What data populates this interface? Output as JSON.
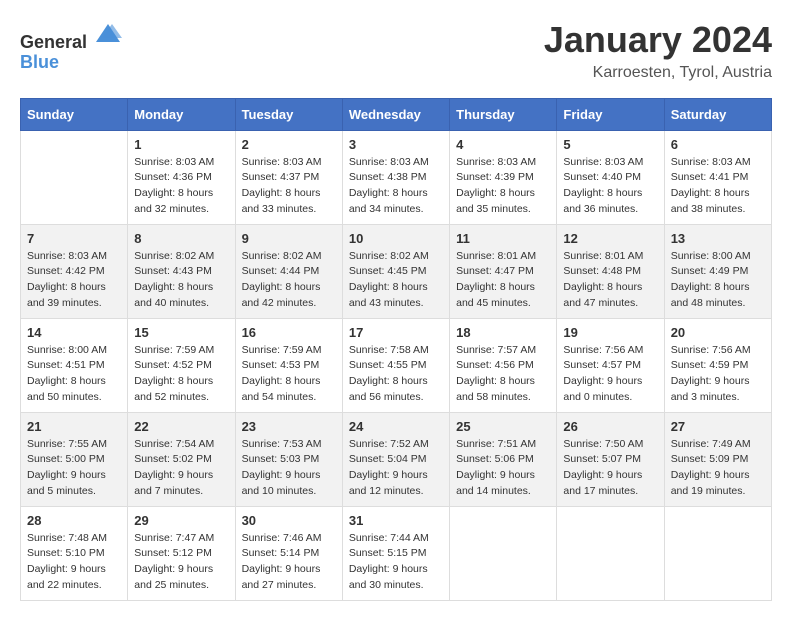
{
  "logo": {
    "general": "General",
    "blue": "Blue"
  },
  "title": "January 2024",
  "subtitle": "Karroesten, Tyrol, Austria",
  "headers": [
    "Sunday",
    "Monday",
    "Tuesday",
    "Wednesday",
    "Thursday",
    "Friday",
    "Saturday"
  ],
  "weeks": [
    {
      "days": [
        {
          "number": "",
          "sunrise": "",
          "sunset": "",
          "daylight": ""
        },
        {
          "number": "1",
          "sunrise": "Sunrise: 8:03 AM",
          "sunset": "Sunset: 4:36 PM",
          "daylight": "Daylight: 8 hours and 32 minutes."
        },
        {
          "number": "2",
          "sunrise": "Sunrise: 8:03 AM",
          "sunset": "Sunset: 4:37 PM",
          "daylight": "Daylight: 8 hours and 33 minutes."
        },
        {
          "number": "3",
          "sunrise": "Sunrise: 8:03 AM",
          "sunset": "Sunset: 4:38 PM",
          "daylight": "Daylight: 8 hours and 34 minutes."
        },
        {
          "number": "4",
          "sunrise": "Sunrise: 8:03 AM",
          "sunset": "Sunset: 4:39 PM",
          "daylight": "Daylight: 8 hours and 35 minutes."
        },
        {
          "number": "5",
          "sunrise": "Sunrise: 8:03 AM",
          "sunset": "Sunset: 4:40 PM",
          "daylight": "Daylight: 8 hours and 36 minutes."
        },
        {
          "number": "6",
          "sunrise": "Sunrise: 8:03 AM",
          "sunset": "Sunset: 4:41 PM",
          "daylight": "Daylight: 8 hours and 38 minutes."
        }
      ]
    },
    {
      "days": [
        {
          "number": "7",
          "sunrise": "Sunrise: 8:03 AM",
          "sunset": "Sunset: 4:42 PM",
          "daylight": "Daylight: 8 hours and 39 minutes."
        },
        {
          "number": "8",
          "sunrise": "Sunrise: 8:02 AM",
          "sunset": "Sunset: 4:43 PM",
          "daylight": "Daylight: 8 hours and 40 minutes."
        },
        {
          "number": "9",
          "sunrise": "Sunrise: 8:02 AM",
          "sunset": "Sunset: 4:44 PM",
          "daylight": "Daylight: 8 hours and 42 minutes."
        },
        {
          "number": "10",
          "sunrise": "Sunrise: 8:02 AM",
          "sunset": "Sunset: 4:45 PM",
          "daylight": "Daylight: 8 hours and 43 minutes."
        },
        {
          "number": "11",
          "sunrise": "Sunrise: 8:01 AM",
          "sunset": "Sunset: 4:47 PM",
          "daylight": "Daylight: 8 hours and 45 minutes."
        },
        {
          "number": "12",
          "sunrise": "Sunrise: 8:01 AM",
          "sunset": "Sunset: 4:48 PM",
          "daylight": "Daylight: 8 hours and 47 minutes."
        },
        {
          "number": "13",
          "sunrise": "Sunrise: 8:00 AM",
          "sunset": "Sunset: 4:49 PM",
          "daylight": "Daylight: 8 hours and 48 minutes."
        }
      ]
    },
    {
      "days": [
        {
          "number": "14",
          "sunrise": "Sunrise: 8:00 AM",
          "sunset": "Sunset: 4:51 PM",
          "daylight": "Daylight: 8 hours and 50 minutes."
        },
        {
          "number": "15",
          "sunrise": "Sunrise: 7:59 AM",
          "sunset": "Sunset: 4:52 PM",
          "daylight": "Daylight: 8 hours and 52 minutes."
        },
        {
          "number": "16",
          "sunrise": "Sunrise: 7:59 AM",
          "sunset": "Sunset: 4:53 PM",
          "daylight": "Daylight: 8 hours and 54 minutes."
        },
        {
          "number": "17",
          "sunrise": "Sunrise: 7:58 AM",
          "sunset": "Sunset: 4:55 PM",
          "daylight": "Daylight: 8 hours and 56 minutes."
        },
        {
          "number": "18",
          "sunrise": "Sunrise: 7:57 AM",
          "sunset": "Sunset: 4:56 PM",
          "daylight": "Daylight: 8 hours and 58 minutes."
        },
        {
          "number": "19",
          "sunrise": "Sunrise: 7:56 AM",
          "sunset": "Sunset: 4:57 PM",
          "daylight": "Daylight: 9 hours and 0 minutes."
        },
        {
          "number": "20",
          "sunrise": "Sunrise: 7:56 AM",
          "sunset": "Sunset: 4:59 PM",
          "daylight": "Daylight: 9 hours and 3 minutes."
        }
      ]
    },
    {
      "days": [
        {
          "number": "21",
          "sunrise": "Sunrise: 7:55 AM",
          "sunset": "Sunset: 5:00 PM",
          "daylight": "Daylight: 9 hours and 5 minutes."
        },
        {
          "number": "22",
          "sunrise": "Sunrise: 7:54 AM",
          "sunset": "Sunset: 5:02 PM",
          "daylight": "Daylight: 9 hours and 7 minutes."
        },
        {
          "number": "23",
          "sunrise": "Sunrise: 7:53 AM",
          "sunset": "Sunset: 5:03 PM",
          "daylight": "Daylight: 9 hours and 10 minutes."
        },
        {
          "number": "24",
          "sunrise": "Sunrise: 7:52 AM",
          "sunset": "Sunset: 5:04 PM",
          "daylight": "Daylight: 9 hours and 12 minutes."
        },
        {
          "number": "25",
          "sunrise": "Sunrise: 7:51 AM",
          "sunset": "Sunset: 5:06 PM",
          "daylight": "Daylight: 9 hours and 14 minutes."
        },
        {
          "number": "26",
          "sunrise": "Sunrise: 7:50 AM",
          "sunset": "Sunset: 5:07 PM",
          "daylight": "Daylight: 9 hours and 17 minutes."
        },
        {
          "number": "27",
          "sunrise": "Sunrise: 7:49 AM",
          "sunset": "Sunset: 5:09 PM",
          "daylight": "Daylight: 9 hours and 19 minutes."
        }
      ]
    },
    {
      "days": [
        {
          "number": "28",
          "sunrise": "Sunrise: 7:48 AM",
          "sunset": "Sunset: 5:10 PM",
          "daylight": "Daylight: 9 hours and 22 minutes."
        },
        {
          "number": "29",
          "sunrise": "Sunrise: 7:47 AM",
          "sunset": "Sunset: 5:12 PM",
          "daylight": "Daylight: 9 hours and 25 minutes."
        },
        {
          "number": "30",
          "sunrise": "Sunrise: 7:46 AM",
          "sunset": "Sunset: 5:14 PM",
          "daylight": "Daylight: 9 hours and 27 minutes."
        },
        {
          "number": "31",
          "sunrise": "Sunrise: 7:44 AM",
          "sunset": "Sunset: 5:15 PM",
          "daylight": "Daylight: 9 hours and 30 minutes."
        },
        {
          "number": "",
          "sunrise": "",
          "sunset": "",
          "daylight": ""
        },
        {
          "number": "",
          "sunrise": "",
          "sunset": "",
          "daylight": ""
        },
        {
          "number": "",
          "sunrise": "",
          "sunset": "",
          "daylight": ""
        }
      ]
    }
  ]
}
